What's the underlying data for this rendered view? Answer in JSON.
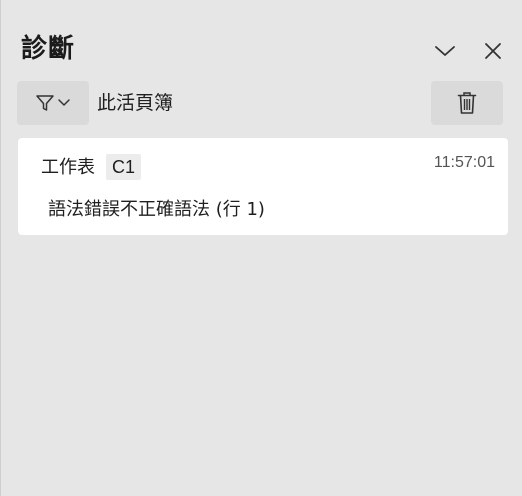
{
  "pane": {
    "title": "診斷"
  },
  "header": {
    "collapse_icon": "chevron-down-icon",
    "close_icon": "close-icon"
  },
  "toolbar": {
    "filter_icon": "filter-icon",
    "scope_label": "此活頁簿",
    "delete_icon": "trash-icon"
  },
  "diagnostics": [
    {
      "sheet": "工作表",
      "cell": "C1",
      "time": "11:57:01",
      "message": "語法錯誤不正確語法 (行 1)"
    }
  ]
}
